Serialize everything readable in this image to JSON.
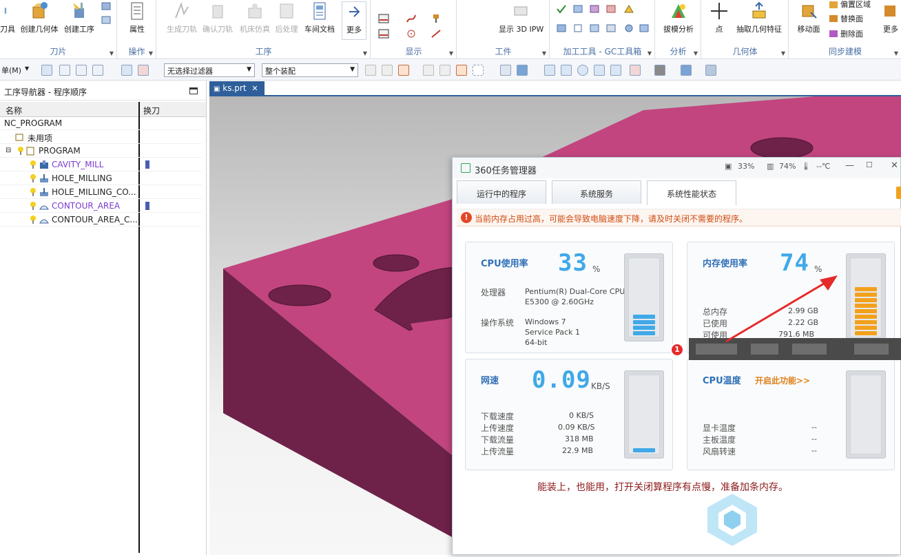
{
  "ribbon": {
    "groups": [
      {
        "label": "刀片",
        "buttons": [
          "刀具",
          "创建几何体",
          "创建工序"
        ]
      },
      {
        "label": "操作",
        "buttons": [
          "属性"
        ]
      },
      {
        "label": "工序",
        "buttons": [
          "生成刀轨",
          "确认刀轨",
          "机床仿真",
          "后处理",
          "车间文档",
          "更多"
        ]
      },
      {
        "label": "显示",
        "buttons": []
      },
      {
        "label": "工件",
        "buttons": [
          "显示 3D IPW"
        ]
      },
      {
        "label": "加工工具 - GC工具箱",
        "buttons": []
      },
      {
        "label": "分析",
        "buttons": [
          "拔模分析"
        ]
      },
      {
        "label": "几何体",
        "buttons": [
          "点",
          "抽取几何特征"
        ]
      },
      {
        "label": "同步建模",
        "buttons": [
          "移动面",
          "偏置区域",
          "替换面",
          "删除面",
          "更多"
        ]
      }
    ]
  },
  "toolbar2": {
    "menu_label": "单(M)",
    "filter_select": "无选择过滤器",
    "assembly_select": "整个装配"
  },
  "navigator": {
    "title": "工序导航器 - 程序顺序",
    "col_name": "名称",
    "col_tool": "换刀",
    "rows": [
      {
        "name": "NC_PROGRAM"
      },
      {
        "name": "未用项"
      },
      {
        "name": "PROGRAM"
      },
      {
        "name": "CAVITY_MILL",
        "highlight": true
      },
      {
        "name": "HOLE_MILLING"
      },
      {
        "name": "HOLE_MILLING_CO..."
      },
      {
        "name": "CONTOUR_AREA",
        "highlight": true
      },
      {
        "name": "CONTOUR_AREA_C..."
      }
    ]
  },
  "file_tab": {
    "label": "ks.prt",
    "close": "✕"
  },
  "task_manager": {
    "title": "360任务管理器",
    "cpu_stat": "33%",
    "mem_stat": "74%",
    "temp_stat": "--℃",
    "tabs": [
      "运行中的程序",
      "系统服务",
      "系统性能状态"
    ],
    "alert": "当前内存占用过高，可能会导致电脑速度下降，请及时关闭不需要的程序。",
    "cpu": {
      "title": "CPU使用率",
      "value": "33",
      "unit": "%",
      "processor_label": "处理器",
      "processor_line1": "Pentium(R) Dual-Core CPU",
      "processor_line2": "E5300 @ 2.60GHz",
      "os_label": "操作系统",
      "os_line1": "Windows 7",
      "os_line2": "Service Pack 1",
      "os_line3": "64-bit",
      "level": 0.33
    },
    "memory": {
      "title": "内存使用率",
      "value": "74",
      "unit": "%",
      "total_label": "总内存",
      "total": "2.99 GB",
      "used_label": "已使用",
      "used": "2.22 GB",
      "avail_label": "可使用",
      "avail": "791.6 MB",
      "level": 0.74
    },
    "network": {
      "title": "网速",
      "value": "0.09",
      "unit": "KB/S",
      "down_label": "下载速度",
      "down": "0 KB/S",
      "up_label": "上传速度",
      "up": "0.09 KB/S",
      "dl_label": "下载流量",
      "dl": "318 MB",
      "ul_label": "上传流量",
      "ul": "22.9 MB"
    },
    "cpu_temp": {
      "title": "CPU温度",
      "enable": "开启此功能>>",
      "gpu_label": "显卡温度",
      "gpu": "--",
      "board_label": "主板温度",
      "board": "--",
      "fan_label": "风扇转速",
      "fan": "--"
    }
  },
  "annotation": {
    "badge": "1",
    "note": "能装上，也能用，打开关闭算程序有点慢，准备加条内存。"
  },
  "colors": {
    "part_top": "#c2457f",
    "part_side": "#6e2249",
    "accent": "#2f6fb7",
    "gauge_blue": "#40a9e8",
    "gauge_orange": "#f2a11c"
  }
}
